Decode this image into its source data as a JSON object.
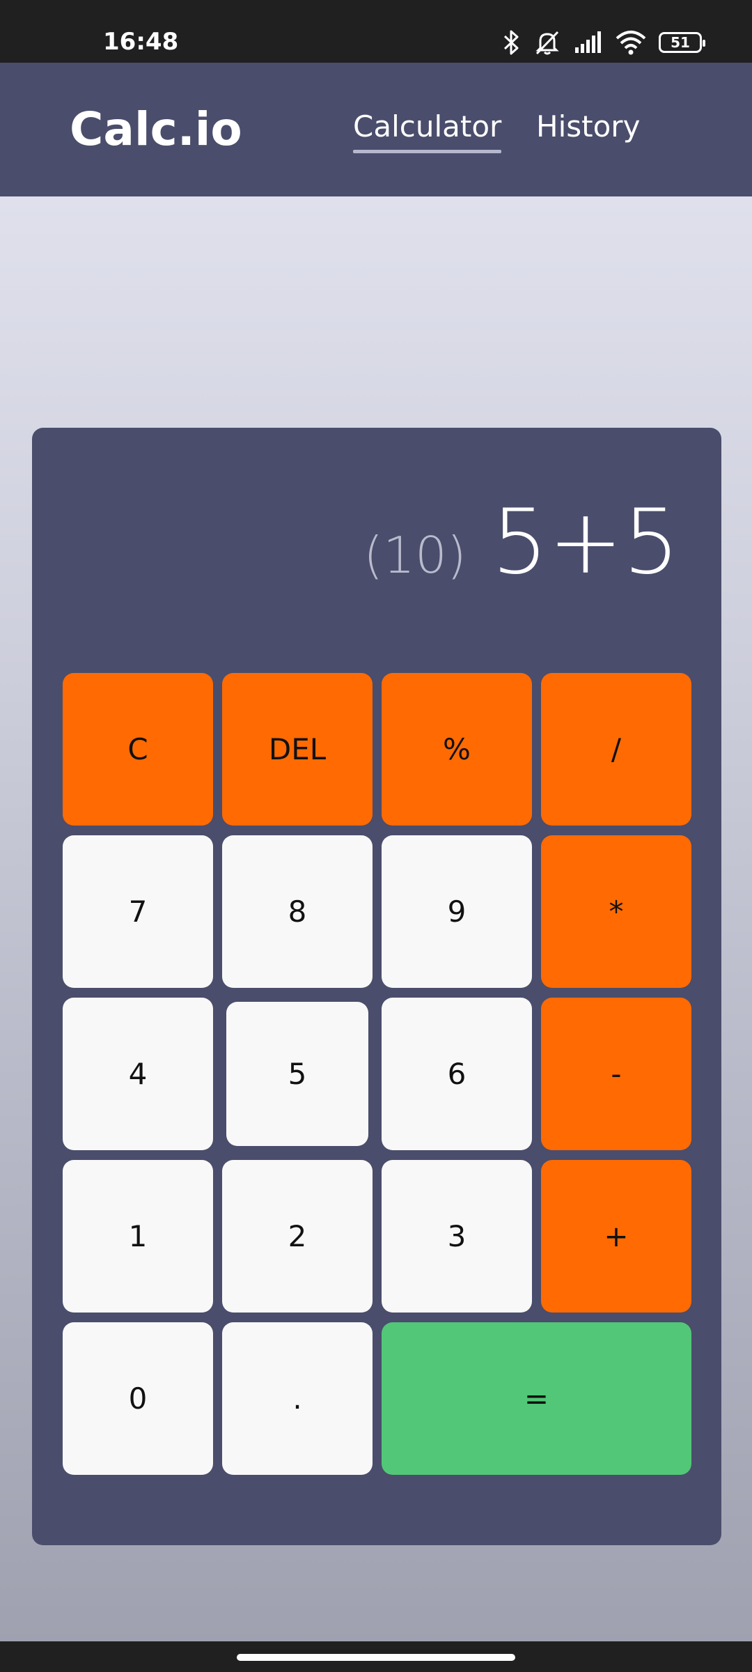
{
  "status_bar": {
    "time": "16:48",
    "battery": "51",
    "icons": [
      "bluetooth-icon",
      "bell-off-icon",
      "signal-icon",
      "wifi-icon",
      "battery-icon"
    ]
  },
  "navbar": {
    "brand": "Calc.io",
    "links": [
      {
        "label": "Calculator",
        "active": true
      },
      {
        "label": "History",
        "active": false
      }
    ]
  },
  "display": {
    "result": "(10)",
    "expression": "5+5"
  },
  "keys": {
    "row1": [
      "C",
      "DEL",
      "%",
      "/"
    ],
    "row2": [
      "7",
      "8",
      "9",
      "*"
    ],
    "row3": [
      "4",
      "5",
      "6",
      "-"
    ],
    "row4": [
      "1",
      "2",
      "3",
      "+"
    ],
    "row5": [
      "0",
      ".",
      "="
    ]
  },
  "colors": {
    "operator": "#ff6a03",
    "number": "#f8f8f8",
    "equals": "#52c777",
    "panel": "#4a4d6b"
  }
}
